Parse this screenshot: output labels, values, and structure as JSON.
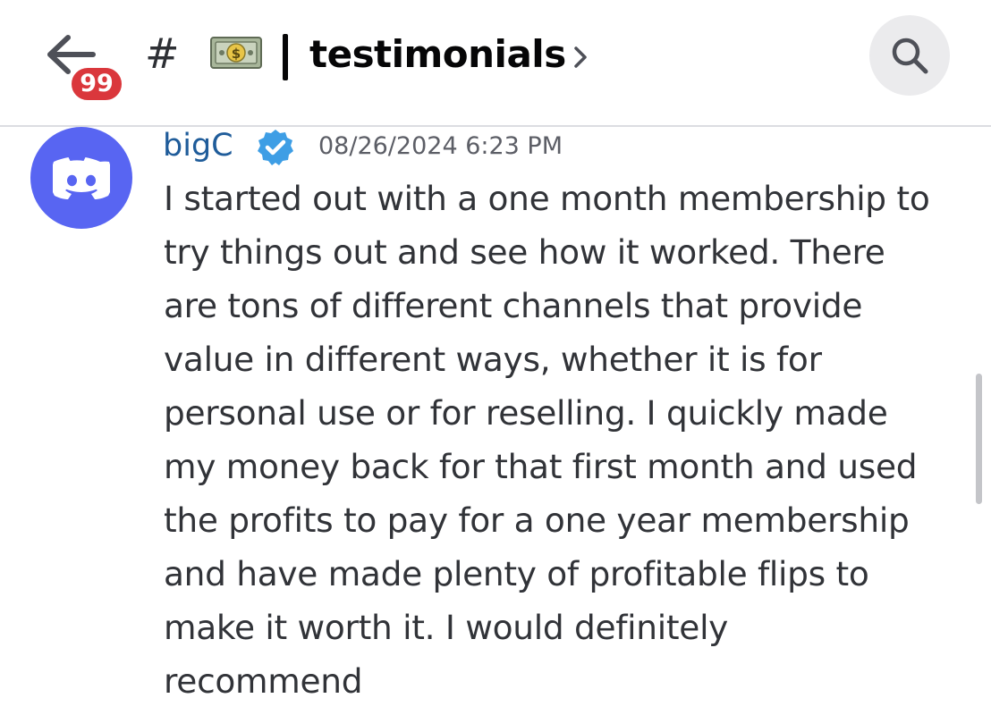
{
  "header": {
    "unread_badge": "99",
    "channel_prefix": "#",
    "channel_emoji": "money-bill-emoji",
    "channel_separator": "|",
    "channel_name": "testimonials",
    "chevron": "›"
  },
  "message": {
    "author": "bigC",
    "timestamp": "08/26/2024 6:23 PM",
    "lines": [
      "I started out with a one month membership to",
      "try things out and see how it worked. There",
      "are tons of different channels that provide",
      "value in different ways, whether it is for",
      "personal use or for reselling. I quickly made",
      "my money back for that first month and used",
      "the profits to pay for a one year membership",
      "and have made plenty of profitable flips to",
      "make it worth it. I would definitely",
      "recommend"
    ]
  },
  "colors": {
    "accent": "#5865f2",
    "badge": "#da373c",
    "verified": "#3e9ee5",
    "author": "#1f5c9a"
  },
  "icons": {
    "back": "arrow-left-icon",
    "search": "search-icon",
    "avatar": "discord-logo-icon",
    "verified": "verified-badge-icon"
  }
}
